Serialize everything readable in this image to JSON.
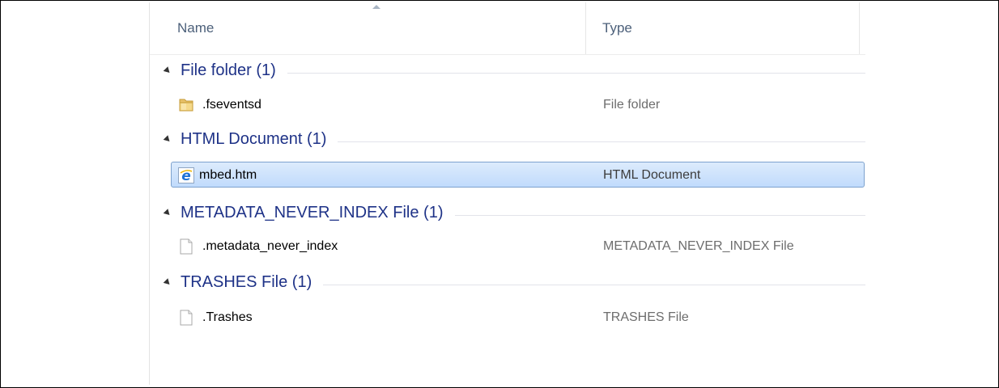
{
  "columns": {
    "name": "Name",
    "type": "Type"
  },
  "groups": [
    {
      "title": "File folder (1)",
      "files": [
        {
          "name": ".fseventsd",
          "type": "File folder",
          "icon": "folder-icon",
          "selected": false
        }
      ]
    },
    {
      "title": "HTML Document (1)",
      "files": [
        {
          "name": "mbed.htm",
          "type": "HTML Document",
          "icon": "internet-explorer-icon",
          "selected": true
        }
      ]
    },
    {
      "title": "METADATA_NEVER_INDEX File (1)",
      "files": [
        {
          "name": ".metadata_never_index",
          "type": "METADATA_NEVER_INDEX File",
          "icon": "blank-file-icon",
          "selected": false
        }
      ]
    },
    {
      "title": "TRASHES File (1)",
      "files": [
        {
          "name": ".Trashes",
          "type": "TRASHES File",
          "icon": "blank-file-icon",
          "selected": false
        }
      ]
    }
  ],
  "colors": {
    "group_title": "#1e3287",
    "selection_border": "#7da2ce",
    "selection_fill": "#c1dbfc"
  }
}
